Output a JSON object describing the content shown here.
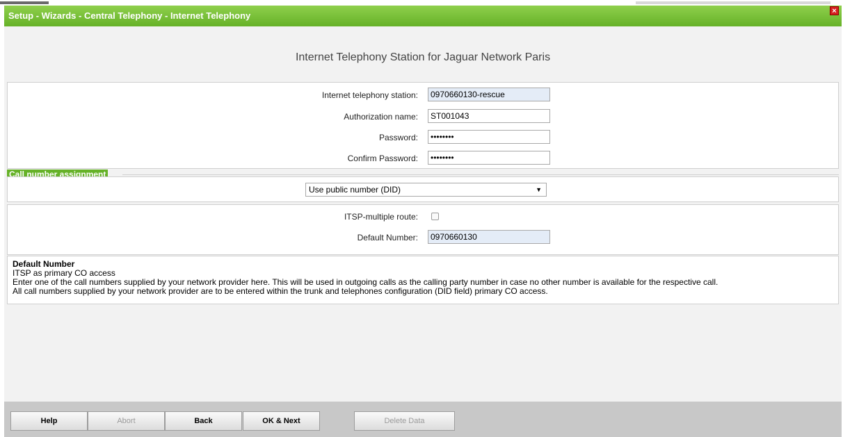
{
  "window": {
    "title": "Setup - Wizards - Central Telephony - Internet Telephony",
    "close_symbol": "×"
  },
  "page": {
    "heading": "Internet Telephony Station for Jaguar Network Paris"
  },
  "station": {
    "internet_telephony_station": {
      "label": "Internet telephony station:",
      "value": "0970660130-rescue"
    },
    "authorization_name": {
      "label": "Authorization name:",
      "value": "ST001043"
    },
    "password": {
      "label": "Password:",
      "value": "••••••••"
    },
    "confirm_password": {
      "label": "Confirm Password:",
      "value": "••••••••"
    }
  },
  "call_number_assignment": {
    "section_title": "Call number assignment",
    "selected_option": "Use public number (DID)",
    "itsp_multiple_route": {
      "label": "ITSP-multiple route:",
      "checked": false
    },
    "default_number": {
      "label": "Default Number:",
      "value": "0970660130"
    }
  },
  "help": {
    "title": "Default Number",
    "lines": [
      "ITSP as primary CO access",
      "Enter one of the call numbers supplied by your network provider here. This will be used in outgoing calls as the calling party number in case no other number is available for the respective call.",
      "All call numbers supplied by your network provider are to be entered within the trunk and telephones configuration (DID field) primary CO access."
    ]
  },
  "buttons": {
    "help": "Help",
    "abort": "Abort",
    "back": "Back",
    "ok_next": "OK & Next",
    "delete_data": "Delete Data"
  },
  "colors": {
    "titlebar": "#66b228",
    "highlight": "#ffff33"
  }
}
